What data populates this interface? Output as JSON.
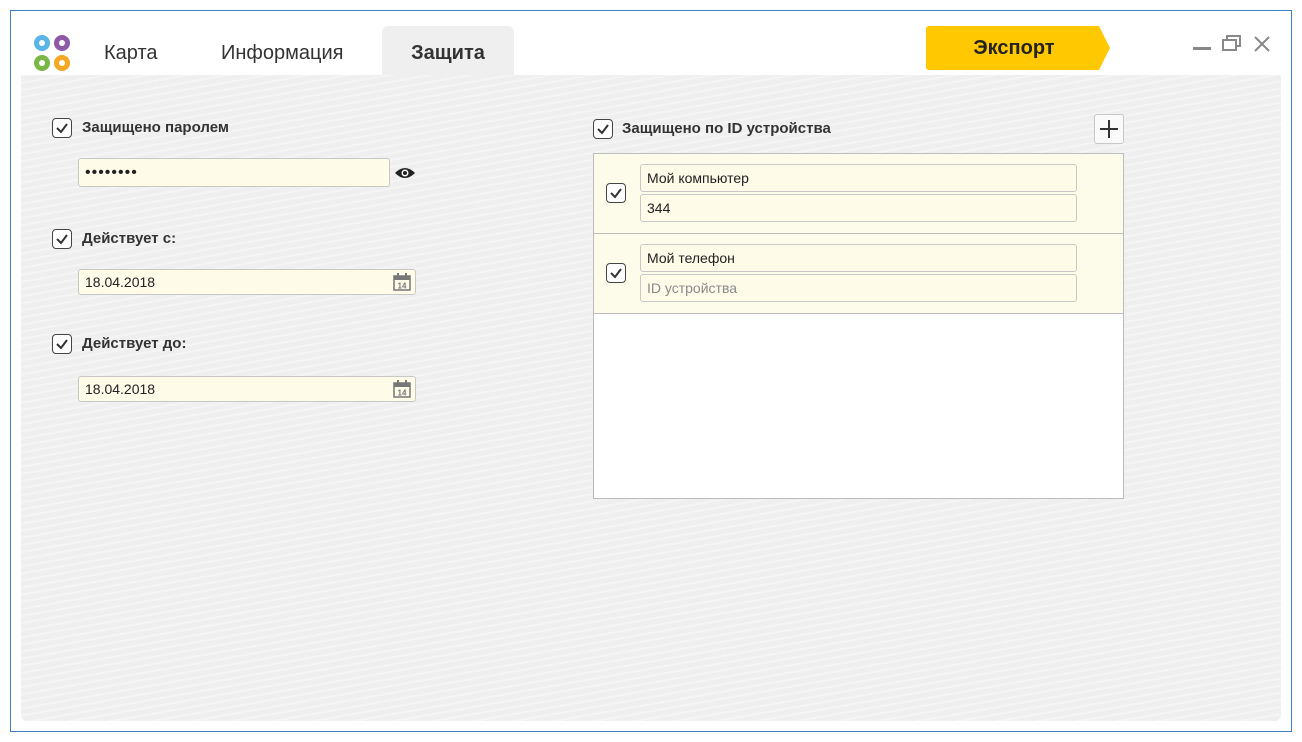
{
  "tabs": [
    {
      "label": "Карта",
      "active": false
    },
    {
      "label": "Информация",
      "active": false
    },
    {
      "label": "Защита",
      "active": true
    }
  ],
  "export_label": "Экспорт",
  "window_controls": [
    "minimize-icon",
    "restore-icon",
    "close-icon"
  ],
  "colors": {
    "accent": "#ffc800",
    "field_bg": "#fefbe9",
    "window_border": "#3d7fc6"
  },
  "password": {
    "checked": true,
    "label": "Защищено паролем",
    "value": "••••••••"
  },
  "valid_from": {
    "checked": true,
    "label": "Действует с:",
    "value": "18.04.2018"
  },
  "valid_to": {
    "checked": true,
    "label": "Действует до:",
    "value": "18.04.2018"
  },
  "device_protection": {
    "checked": true,
    "label": "Защищено по ID устройства",
    "devices": [
      {
        "checked": true,
        "name": "Мой компьютер",
        "id": "344",
        "id_placeholder": "ID устройства"
      },
      {
        "checked": true,
        "name": "Мой телефон",
        "id": "",
        "id_placeholder": "ID устройства"
      }
    ]
  },
  "calendar_day": "14"
}
